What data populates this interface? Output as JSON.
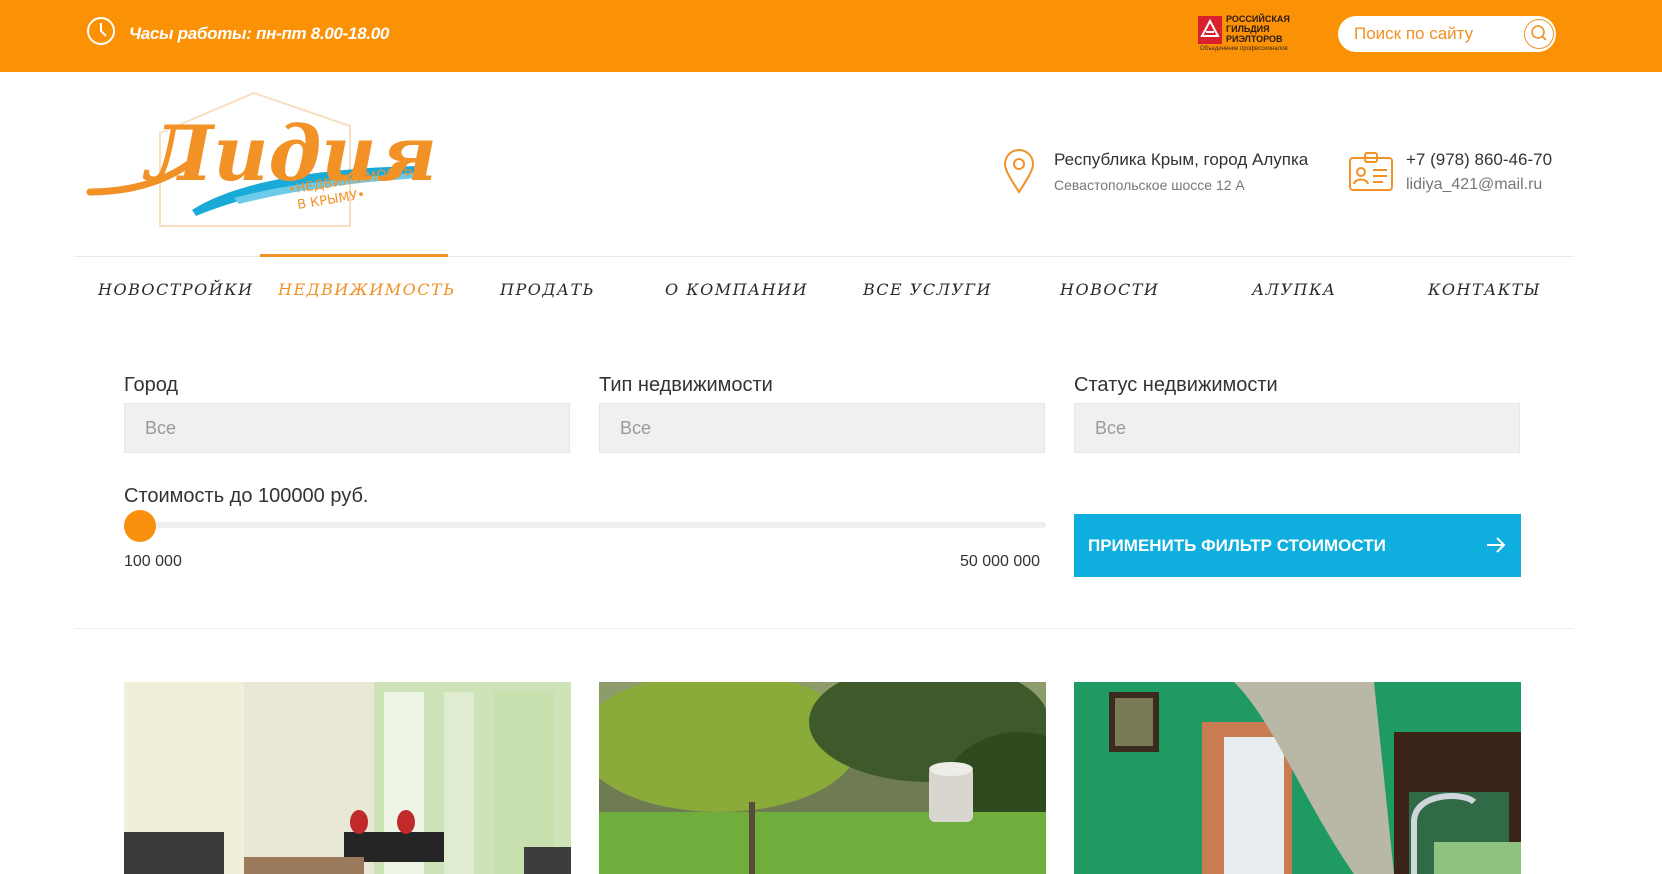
{
  "topbar": {
    "hours": "Часы работы: пн-пт 8.00-18.00",
    "guild": {
      "line1": "РОССИЙСКАЯ",
      "line2": "ГИЛЬДИЯ",
      "line3": "РИЭЛТОРОВ",
      "sub": "Объединение профессионалов"
    },
    "search_placeholder": "Поиск по сайту"
  },
  "logo": {
    "script": "Лидия",
    "tagline1": "•НЕДВИЖИМОСТЬ",
    "tagline2": "В КРЫМУ•"
  },
  "contacts": {
    "address_line1": "Республика Крым, город Алупка",
    "address_line2": "Севастопольское шоссе 12 А",
    "phone": "+7 (978) 860-46-70",
    "email": "lidiya_421@mail.ru"
  },
  "nav": {
    "items": [
      {
        "label": "НОВОСТРОЙКИ"
      },
      {
        "label": "НЕДВИЖИМОСТЬ",
        "active": true
      },
      {
        "label": "ПРОДАТЬ"
      },
      {
        "label": "О КОМПАНИИ"
      },
      {
        "label": "ВСЕ УСЛУГИ"
      },
      {
        "label": "НОВОСТИ"
      },
      {
        "label": "АЛУПКА"
      },
      {
        "label": "КОНТАКТЫ"
      }
    ]
  },
  "filters": {
    "city": {
      "label": "Город",
      "value": "Все"
    },
    "type": {
      "label": "Тип недвижимости",
      "value": "Все"
    },
    "status": {
      "label": "Статус недвижимости",
      "value": "Все"
    },
    "price_label": "Стоимость до 100000 руб.",
    "price_min_label": "100 000",
    "price_max_label": "50 000 000",
    "price_min": 100000,
    "price_max": 50000000,
    "price_value": 100000,
    "apply_label": "ПРИМЕНИТЬ ФИЛЬТР СТОИМОСТИ"
  },
  "colors": {
    "accent_orange": "#fb9205",
    "button_blue": "#0eaede",
    "select_bg": "#eff0f1"
  }
}
